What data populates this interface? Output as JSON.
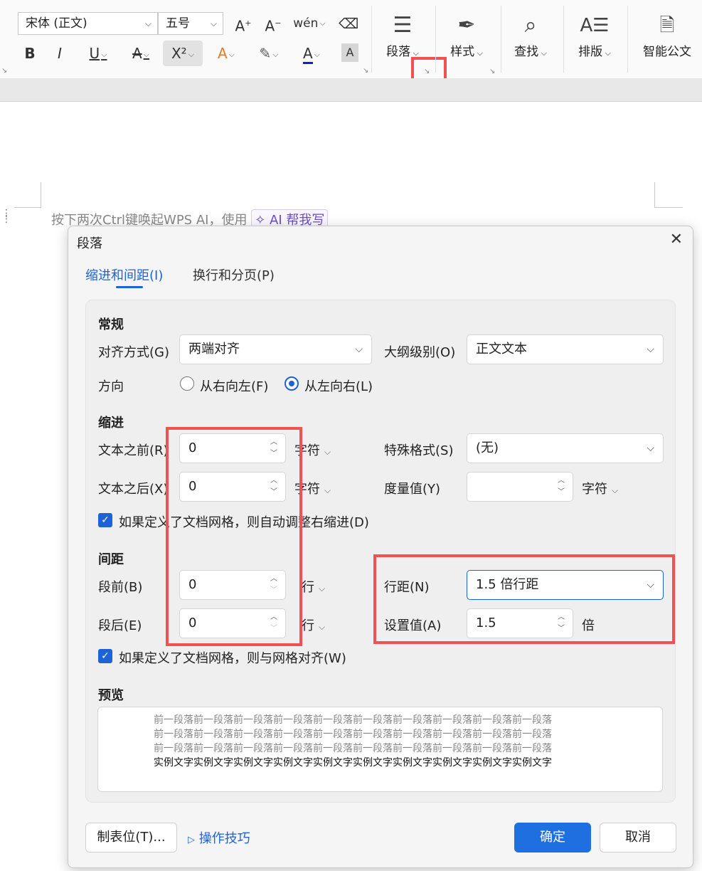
{
  "ribbon": {
    "font_name": "宋体 (正文)",
    "font_size": "五号",
    "paragraph_label": "段落",
    "styles_label": "样式",
    "find_label": "查找",
    "layout_label": "排版",
    "smart_doc_label": "智能公文"
  },
  "document": {
    "hint_text": "按下两次Ctrl键唤起WPS AI，使用",
    "ai_button": "AI 帮我写"
  },
  "dialog": {
    "title": "段落",
    "tabs": [
      "缩进和间距(I)",
      "换行和分页(P)"
    ],
    "general": {
      "heading": "常规",
      "alignment_label": "对齐方式(G)",
      "alignment_value": "两端对齐",
      "outline_label": "大纲级别(O)",
      "outline_value": "正文文本",
      "direction_label": "方向",
      "rtl_label": "从右向左(F)",
      "ltr_label": "从左向右(L)"
    },
    "indent": {
      "heading": "缩进",
      "before_label": "文本之前(R)",
      "before_value": "0",
      "before_unit": "字符",
      "after_label": "文本之后(X)",
      "after_value": "0",
      "after_unit": "字符",
      "special_label": "特殊格式(S)",
      "special_value": "(无)",
      "measure_label": "度量值(Y)",
      "measure_value": "",
      "measure_unit": "字符",
      "auto_adjust_label": "如果定义了文档网格，则自动调整右缩进(D)"
    },
    "spacing": {
      "heading": "间距",
      "before_label": "段前(B)",
      "before_value": "0",
      "before_unit": "行",
      "after_label": "段后(E)",
      "after_value": "0",
      "after_unit": "行",
      "line_label": "行距(N)",
      "line_value": "1.5 倍行距",
      "setting_label": "设置值(A)",
      "setting_value": "1.5",
      "setting_unit": "倍",
      "snap_grid_label": "如果定义了文档网格，则与网格对齐(W)"
    },
    "preview": {
      "heading": "预览",
      "prev_line": "前一段落前一段落前一段落前一段落前一段落前一段落前一段落前一段落前一段落前一段落",
      "sample_line": "实例文字实例文字实例文字实例文字实例文字实例文字实例文字实例文字实例文字实例文字"
    },
    "tabs_button": "制表位(T)...",
    "tips_link": "操作技巧",
    "ok_button": "确定",
    "cancel_button": "取消"
  },
  "colors": {
    "accent": "#1e63d6",
    "highlight": "#f05252"
  }
}
